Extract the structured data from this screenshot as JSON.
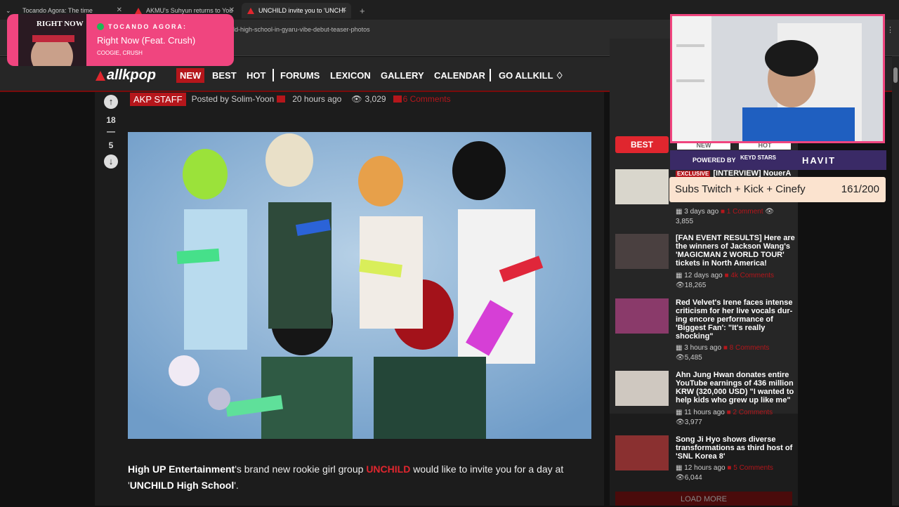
{
  "browser": {
    "tabs": [
      {
        "title": "Tocando Agora: The time"
      },
      {
        "title": "AKMU's Suhyun returns to You"
      },
      {
        "title": "UNCHILD invite you to 'UNCHI"
      }
    ],
    "url": "ild-high-school-in-gyaru-vibe-debut-teaser-photos",
    "new_tab": "+"
  },
  "site": {
    "logo": "allkpop",
    "nav": [
      "NEW",
      "BEST",
      "HOT",
      "FORUMS",
      "LEXICON",
      "GALLERY",
      "CALENDAR",
      "GO ALLKILL"
    ]
  },
  "article": {
    "staff_badge": "AKP STAFF",
    "posted_by": "Posted by Solim-Yoon",
    "time_ago": "20 hours ago",
    "views": "3,029",
    "comments": "6 Comments",
    "upvotes": "18",
    "dash": "—",
    "downvotes": "5",
    "body": {
      "agency": "High UP Entertainment",
      "text1": "'s brand new rookie girl group ",
      "group": "UNCHILD",
      "text2": " would like to invite you for a day at '",
      "school": "UNCHILD High School",
      "text3": "'."
    }
  },
  "sidebar": {
    "tabs": [
      "BEST",
      "NEW",
      "HOT"
    ],
    "items": [
      {
        "badge": "EXCLUSIVE",
        "title": "[INTERVIEW] NouerA",
        "time": "3 days ago",
        "comments": "1 Comment",
        "views": "3,855",
        "thumb_color": "#d9d6cc"
      },
      {
        "title": "[FAN EVENT RESULTS] Here are the winners of Jackson Wang's 'MAGICMAN 2 WORLD TOUR' tickets in North America!",
        "time": "12 days ago",
        "comments": "4k Comments",
        "views": "18,265",
        "thumb_color": "#4a4040"
      },
      {
        "title": "Red Velvet's Irene faces intense criticism for her live vocals dur-ing encore performance of 'Biggest Fan': \"It's really shocking\"",
        "time": "3 hours ago",
        "comments": "8 Comments",
        "views": "5,485",
        "thumb_color": "#8a3a6a"
      },
      {
        "title": "Ahn Jung Hwan donates entire YouTube earnings of 436 million KRW (320,000 USD) \"I wanted to help kids who grew up like me\"",
        "time": "11 hours ago",
        "comments": "2 Comments",
        "views": "3,977",
        "thumb_color": "#cfc8c0"
      },
      {
        "title": "Song Ji Hyo shows diverse transformations as third host of 'SNL Korea 8'",
        "time": "12 hours ago",
        "comments": "5 Comments",
        "views": "6,044",
        "thumb_color": "#8a3030"
      }
    ],
    "load_more": "LOAD MORE"
  },
  "overlay": {
    "now_playing_heading": "TOCANDO AGORA:",
    "song": "Right Now (Feat. Crush)",
    "artist": "COOGIE, CRUSH",
    "art_text": "RIGHT NOW",
    "powered_by": "POWERED BY",
    "sponsor1": "KEYD STARS",
    "sponsor2": "HAVIT",
    "subs_label": "Subs Twitch + Kick + Cinefy",
    "subs_count": "161/200"
  },
  "colors": {
    "accent": "#b5161b",
    "overlay_pink": "#f0457f"
  }
}
